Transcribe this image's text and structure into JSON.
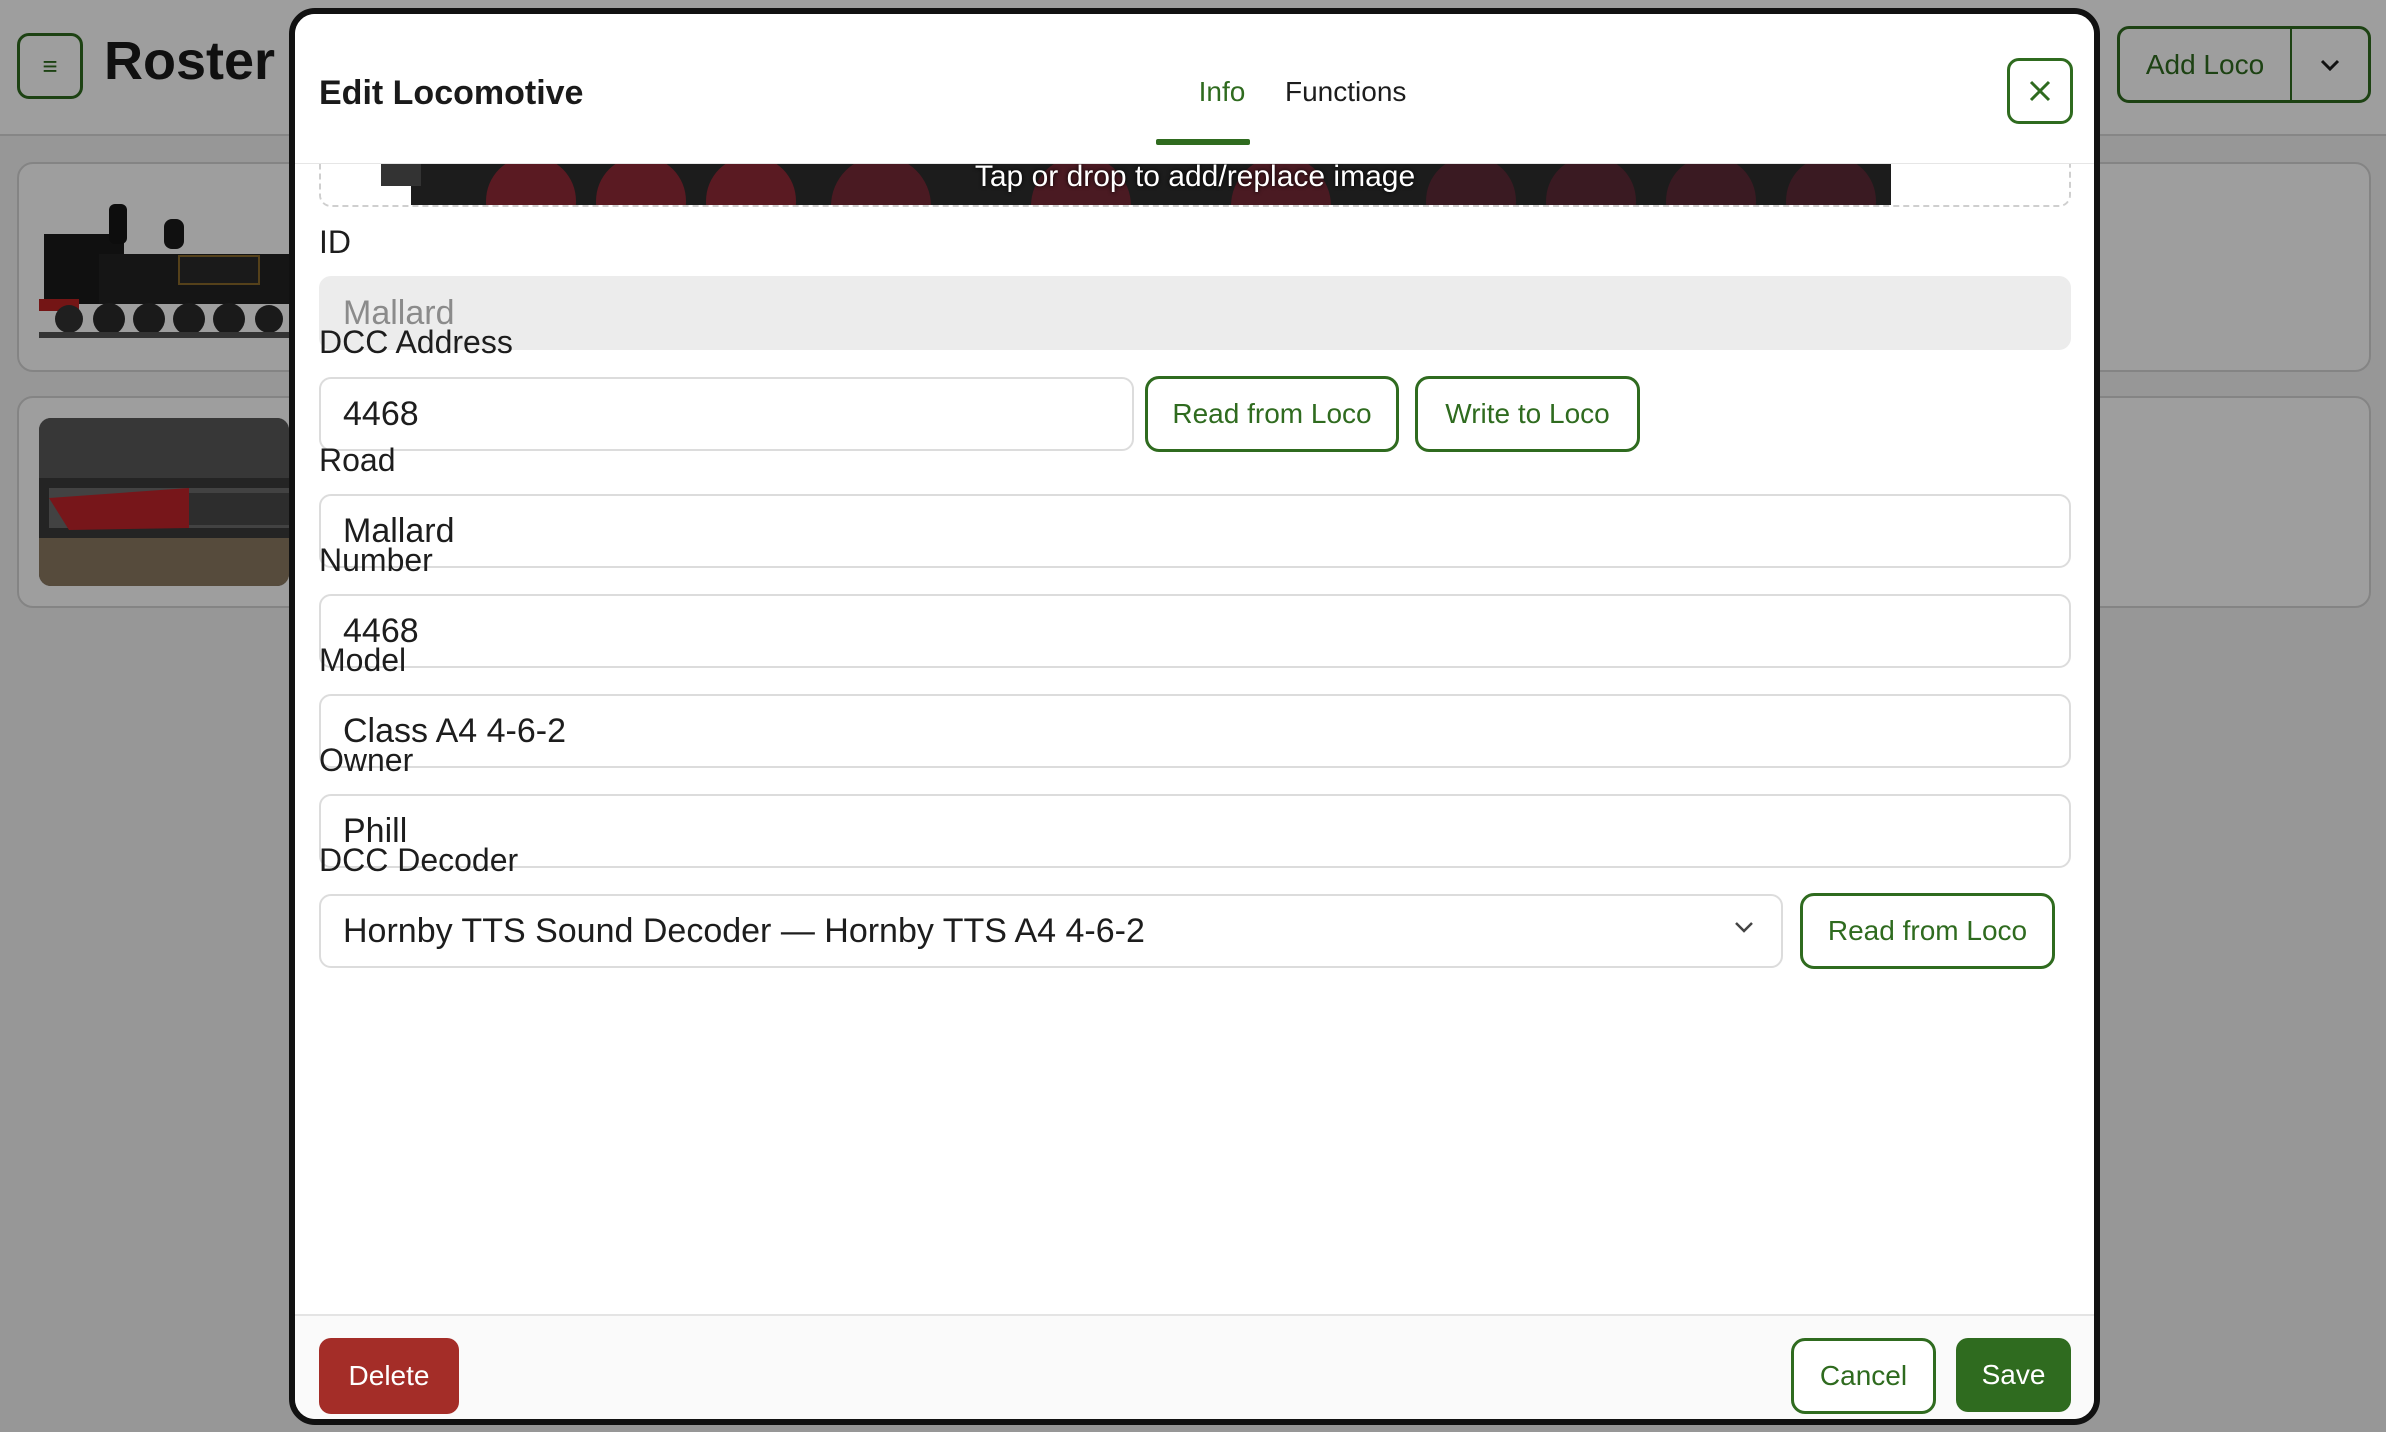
{
  "app": {
    "title": "Roster",
    "menu_icon": "hamburger-icon",
    "add_label": "Add Loco"
  },
  "roster": {
    "items": [
      {
        "image": "black tank steam locomotive"
      },
      {
        "image": "red and grey diesel train"
      }
    ]
  },
  "modal": {
    "title": "Edit Locomotive",
    "tabs": [
      {
        "label": "Info",
        "active": true
      },
      {
        "label": "Functions",
        "active": false
      }
    ],
    "image_hint": "Tap or drop to add/replace image",
    "fields": {
      "id": {
        "label": "ID",
        "value": "Mallard"
      },
      "dcc_address": {
        "label": "DCC Address",
        "value": "4468",
        "read_label": "Read from Loco",
        "write_label": "Write to Loco"
      },
      "road": {
        "label": "Road",
        "value": "Mallard"
      },
      "number": {
        "label": "Number",
        "value": "4468"
      },
      "model": {
        "label": "Model",
        "value": "Class A4 4-6-2"
      },
      "owner": {
        "label": "Owner",
        "value": "Phill"
      },
      "decoder": {
        "label": "DCC Decoder",
        "value": "Hornby TTS Sound Decoder — Hornby TTS A4 4-6-2",
        "read_label": "Read from Loco"
      }
    },
    "footer": {
      "delete_label": "Delete",
      "cancel_label": "Cancel",
      "save_label": "Save"
    }
  },
  "colors": {
    "accent": "#2f6b1f",
    "danger": "#a42d28",
    "disabled_bg": "#ececec"
  }
}
